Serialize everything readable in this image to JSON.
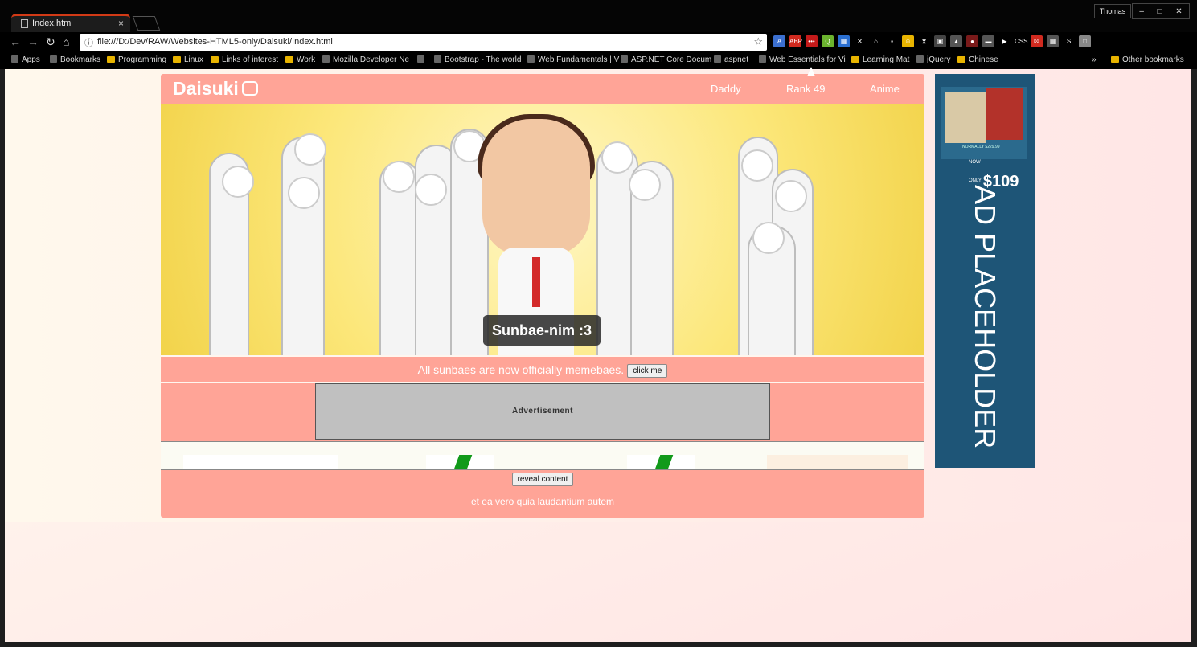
{
  "browser": {
    "tab_title": "Index.html",
    "tab_close": "×",
    "user_name": "Thomas",
    "window_buttons": [
      "–",
      "□",
      "✕"
    ],
    "url": "file:///D:/Dev/RAW/Websites-HTML5-only/Daisuki/Index.html",
    "bookmarks": [
      {
        "label": "Apps",
        "icon": "apps-grid-icon"
      },
      {
        "label": "Bookmarks",
        "icon": "star-icon"
      },
      {
        "label": "Programming",
        "icon": "folder-icon"
      },
      {
        "label": "Linux",
        "icon": "folder-icon"
      },
      {
        "label": "Links of interest",
        "icon": "folder-icon"
      },
      {
        "label": "Work",
        "icon": "folder-icon"
      },
      {
        "label": "Mozilla Developer Ne",
        "icon": "mdn-icon"
      },
      {
        "label": "",
        "icon": "page-icon"
      },
      {
        "label": "Bootstrap - The world",
        "icon": "bootstrap-icon"
      },
      {
        "label": "Web Fundamentals | V",
        "icon": "web-fundamentals-icon"
      },
      {
        "label": "ASP.NET Core Docum",
        "icon": "microsoft-icon"
      },
      {
        "label": "aspnet",
        "icon": "github-icon"
      },
      {
        "label": "Web Essentials for Vi",
        "icon": "web-essentials-icon"
      },
      {
        "label": "Learning Mat",
        "icon": "folder-icon"
      },
      {
        "label": "jQuery",
        "icon": "jquery-icon"
      },
      {
        "label": "Chinese",
        "icon": "folder-icon"
      }
    ],
    "overflow_chevron": "»",
    "other_bookmarks": "Other bookmarks",
    "extensions": [
      {
        "name": "translate-icon",
        "color": "#3b6fcf",
        "glyph": "A"
      },
      {
        "name": "adblock-icon",
        "color": "#d12a1f",
        "glyph": "ABP"
      },
      {
        "name": "lastpass-icon",
        "color": "#c41a1a",
        "glyph": "•••"
      },
      {
        "name": "q-icon",
        "color": "#6bb32e",
        "glyph": "Q"
      },
      {
        "name": "calendar-icon",
        "color": "#2a6fd1",
        "glyph": "▦"
      },
      {
        "name": "x-icon",
        "color": "#000000",
        "glyph": "✕"
      },
      {
        "name": "home-icon",
        "color": "#000000",
        "glyph": "⌂"
      },
      {
        "name": "note-icon",
        "color": "#000000",
        "glyph": "▪"
      },
      {
        "name": "emoji-icon",
        "color": "#e8b400",
        "glyph": "☺"
      },
      {
        "name": "hourglass-icon",
        "color": "#000000",
        "glyph": "⧗"
      },
      {
        "name": "screenshot-icon",
        "color": "#444444",
        "glyph": "▣"
      },
      {
        "name": "drive-icon",
        "color": "#555555",
        "glyph": "▲"
      },
      {
        "name": "record-icon",
        "color": "#7a1a1a",
        "glyph": "●"
      },
      {
        "name": "comment-icon",
        "color": "#555555",
        "glyph": "▬"
      },
      {
        "name": "play-icon",
        "color": "#000000",
        "glyph": "▶"
      },
      {
        "name": "css-icon",
        "color": "#000000",
        "glyph": "CSS"
      },
      {
        "name": "dice-icon",
        "color": "#d12a1f",
        "glyph": "⚄"
      },
      {
        "name": "grid-icon",
        "color": "#555555",
        "glyph": "▦"
      },
      {
        "name": "s-icon",
        "color": "#000000",
        "glyph": "S"
      },
      {
        "name": "window-icon",
        "color": "#888888",
        "glyph": "□"
      },
      {
        "name": "menu-icon",
        "color": "#000000",
        "glyph": "⋮"
      }
    ]
  },
  "page": {
    "logo_text": "Daisuki",
    "nav": [
      "Daddy",
      "Rank 49",
      "Anime"
    ],
    "hero_caption": "Sunbae-nim :3",
    "banner_text": "All sunbaes are now officially memebaes.",
    "banner_button": "click me",
    "ad_label": "Advertisement",
    "reveal_button": "reveal content",
    "lorem": "et ea vero quia laudantium autem",
    "side_ad": {
      "promo_line1": "NORMALLY $229.99",
      "promo_now": "NOW ONLY",
      "promo_price": "$109",
      "placeholder": "AD PLACEHOLDER"
    }
  },
  "colors": {
    "accent": "#ffa497",
    "tab_border": "#d23a16",
    "side_ad_bg": "#1e5577"
  }
}
